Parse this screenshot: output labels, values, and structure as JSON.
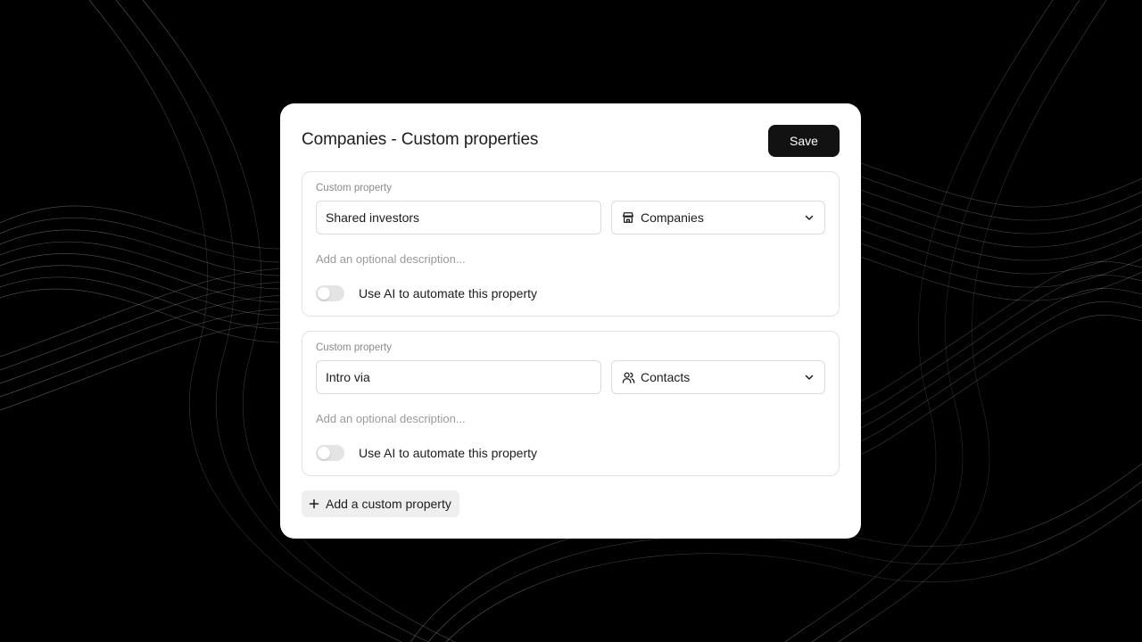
{
  "modal": {
    "title": "Companies - Custom properties",
    "save_label": "Save"
  },
  "properties": [
    {
      "label": "Custom property",
      "name": "Shared investors",
      "type": "Companies",
      "type_icon": "building-icon",
      "description_placeholder": "Add an optional description...",
      "ai_toggle_label": "Use AI to automate this property",
      "ai_enabled": false
    },
    {
      "label": "Custom property",
      "name": "Intro via",
      "type": "Contacts",
      "type_icon": "users-icon",
      "description_placeholder": "Add an optional description...",
      "ai_toggle_label": "Use AI to automate this property",
      "ai_enabled": false
    }
  ],
  "add_property_label": "Add a custom property",
  "colors": {
    "backdrop": "#000000",
    "modal_bg": "#ffffff",
    "primary_button": "#121212",
    "muted_text": "#8a8a8a",
    "border": "#e2e2e2"
  }
}
